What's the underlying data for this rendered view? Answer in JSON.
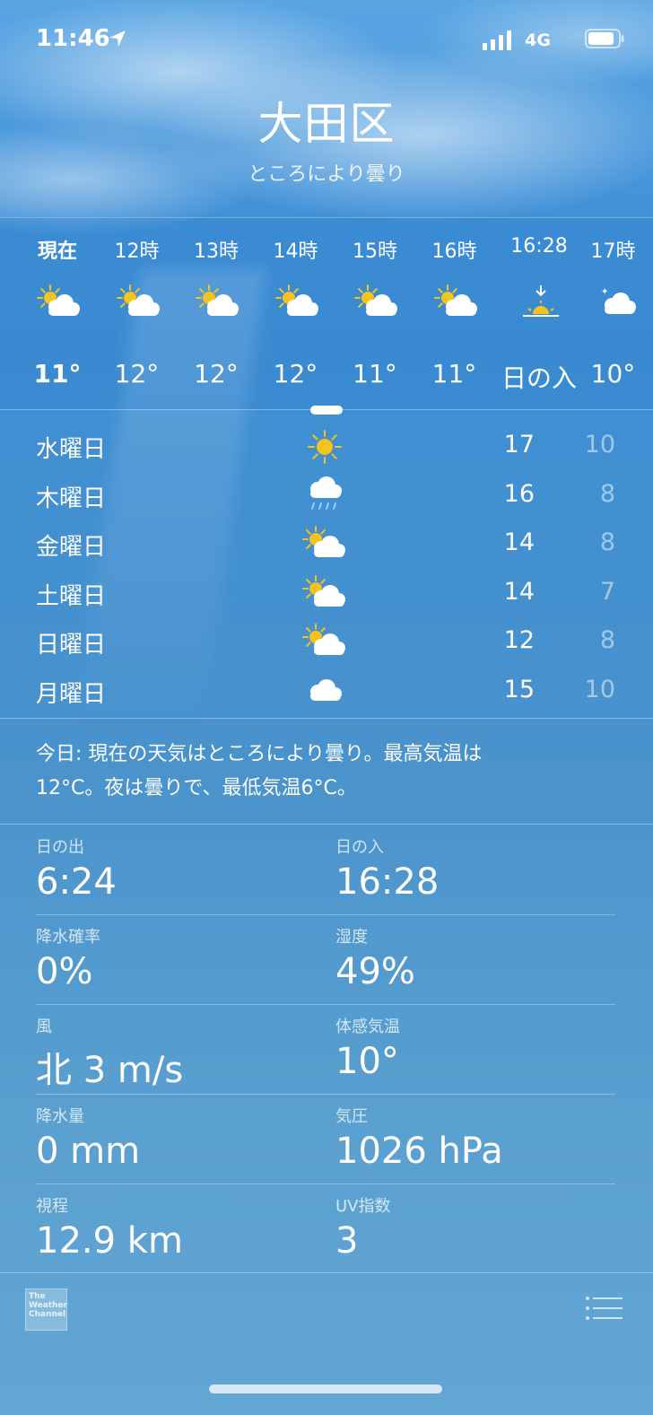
{
  "status": {
    "time": "11:46",
    "network": "4G"
  },
  "header": {
    "city": "大田区",
    "condition": "ところにより曇り"
  },
  "hourly": [
    {
      "label": "現在",
      "icon": "partly-sunny-icon",
      "temp": "11°",
      "bold": true
    },
    {
      "label": "12時",
      "icon": "partly-sunny-icon",
      "temp": "12°"
    },
    {
      "label": "13時",
      "icon": "partly-sunny-icon",
      "temp": "12°"
    },
    {
      "label": "14時",
      "icon": "partly-sunny-icon",
      "temp": "12°"
    },
    {
      "label": "15時",
      "icon": "partly-sunny-icon",
      "temp": "11°"
    },
    {
      "label": "16時",
      "icon": "partly-sunny-icon",
      "temp": "11°"
    },
    {
      "label": "16:28",
      "icon": "sunset-icon",
      "temp": "日の入"
    },
    {
      "label": "17時",
      "icon": "cloudy-night-icon",
      "temp": "10°"
    }
  ],
  "daily": [
    {
      "day": "水曜日",
      "icon": "sunny-icon",
      "high": "17",
      "low": "10"
    },
    {
      "day": "木曜日",
      "icon": "rain-icon",
      "high": "16",
      "low": "8"
    },
    {
      "day": "金曜日",
      "icon": "partly-sunny-icon",
      "high": "14",
      "low": "8"
    },
    {
      "day": "土曜日",
      "icon": "partly-sunny-icon",
      "high": "14",
      "low": "7"
    },
    {
      "day": "日曜日",
      "icon": "partly-sunny-icon",
      "high": "12",
      "low": "8"
    },
    {
      "day": "月曜日",
      "icon": "cloud-icon",
      "high": "15",
      "low": "10"
    }
  ],
  "summary": {
    "line1": "今日: 現在の天気はところにより曇り。最高気温は",
    "line2": "12°C。夜は曇りで、最低気温6°C。"
  },
  "details": [
    {
      "left_label": "日の出",
      "left_value": "6:24",
      "right_label": "日の入",
      "right_value": "16:28"
    },
    {
      "left_label": "降水確率",
      "left_value": "0%",
      "right_label": "湿度",
      "right_value": "49%"
    },
    {
      "left_label": "風",
      "left_value": "北 3 m/s",
      "right_label": "体感気温",
      "right_value": "10°"
    },
    {
      "left_label": "降水量",
      "left_value": "0 mm",
      "right_label": "気圧",
      "right_value": "1026 hPa"
    },
    {
      "left_label": "視程",
      "left_value": "12.9 km",
      "right_label": "UV指数",
      "right_value": "3"
    }
  ],
  "footer": {
    "logo_text": [
      "The",
      "Weather",
      "Channel"
    ]
  },
  "colors": {
    "sun": "#f6c31c",
    "cloud": "#ffffff",
    "rain": "#8fd0ff"
  }
}
